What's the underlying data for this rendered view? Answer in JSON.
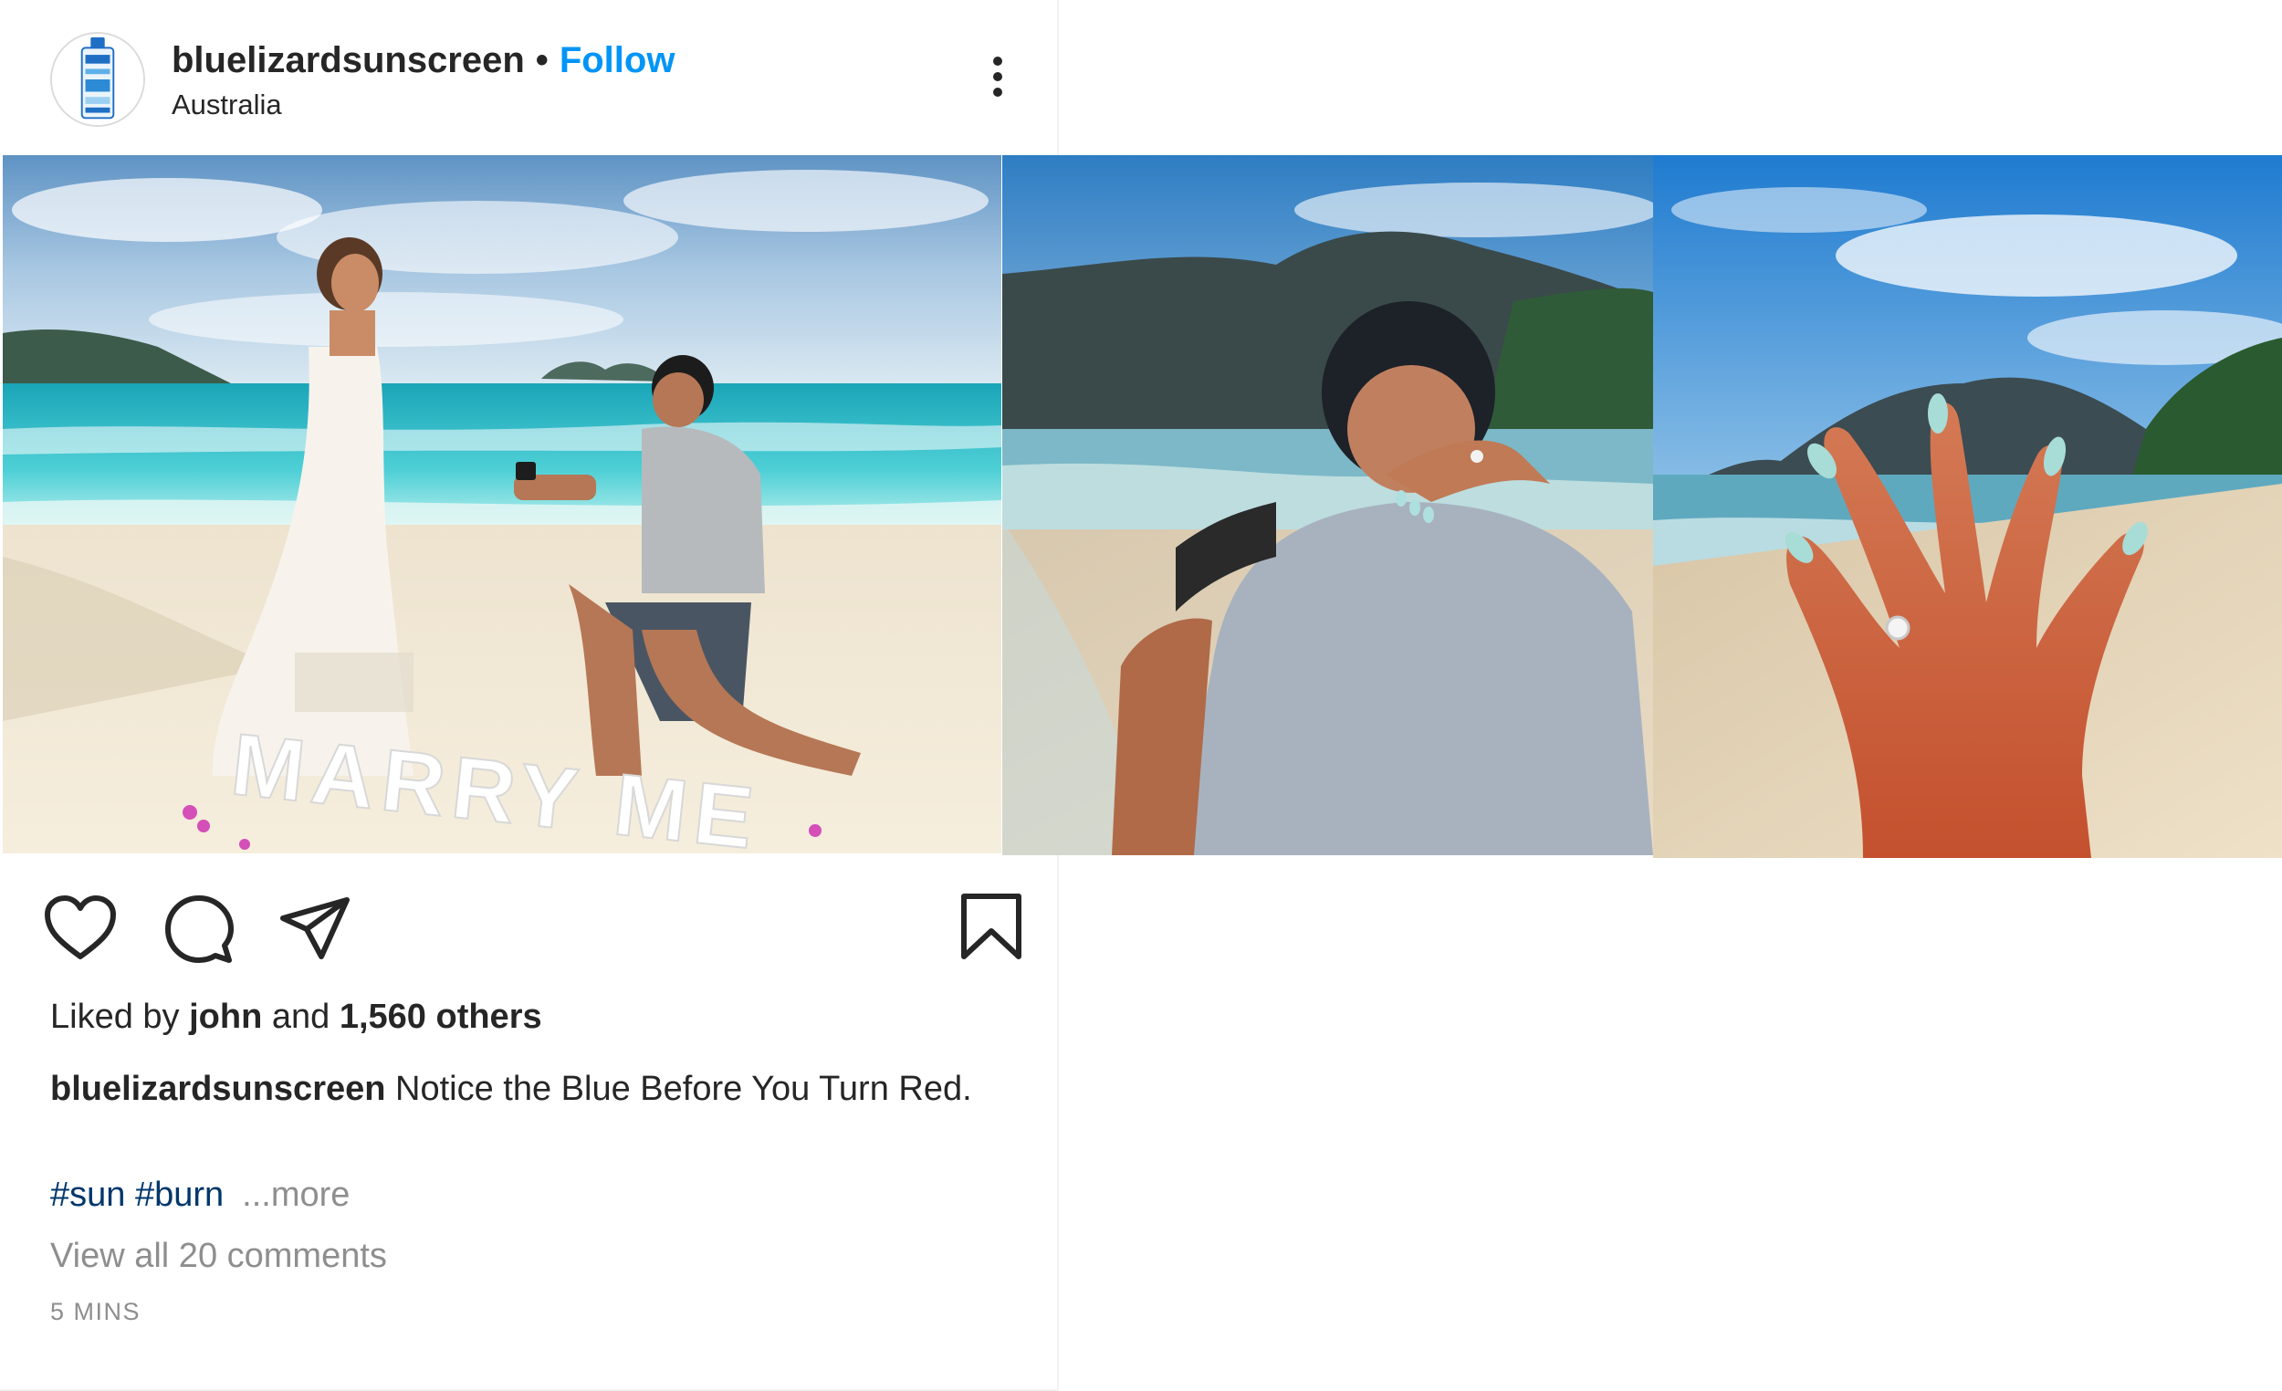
{
  "header": {
    "username": "bluelizardsunscreen",
    "separator": "•",
    "follow_label": "Follow",
    "location": "Australia",
    "avatar_icon": "sunscreen-bottle-icon",
    "more_icon": "more-options-icon"
  },
  "photos": [
    {
      "icon": "beach-proposal-photo",
      "sign_text": "MARRY ME"
    },
    {
      "icon": "couple-embrace-photo"
    },
    {
      "icon": "ring-hand-photo"
    }
  ],
  "actions": {
    "like_icon": "heart-icon",
    "comment_icon": "comment-icon",
    "share_icon": "share-icon",
    "save_icon": "bookmark-icon"
  },
  "likes": {
    "prefix": "Liked by ",
    "user": "john",
    "middle": " and ",
    "count": "1,560 others"
  },
  "caption": {
    "user": "bluelizardsunscreen",
    "text": " Notice the Blue Before You Turn Red."
  },
  "hashtags": [
    "#sun",
    "#burn"
  ],
  "more_label": "...more",
  "view_comments": "View all 20 comments",
  "timestamp": "5 MINS",
  "colors": {
    "follow_blue": "#0095f6",
    "hashtag_blue": "#00376b",
    "secondary_grey": "#8e8e8e",
    "text_dark": "#262626"
  }
}
